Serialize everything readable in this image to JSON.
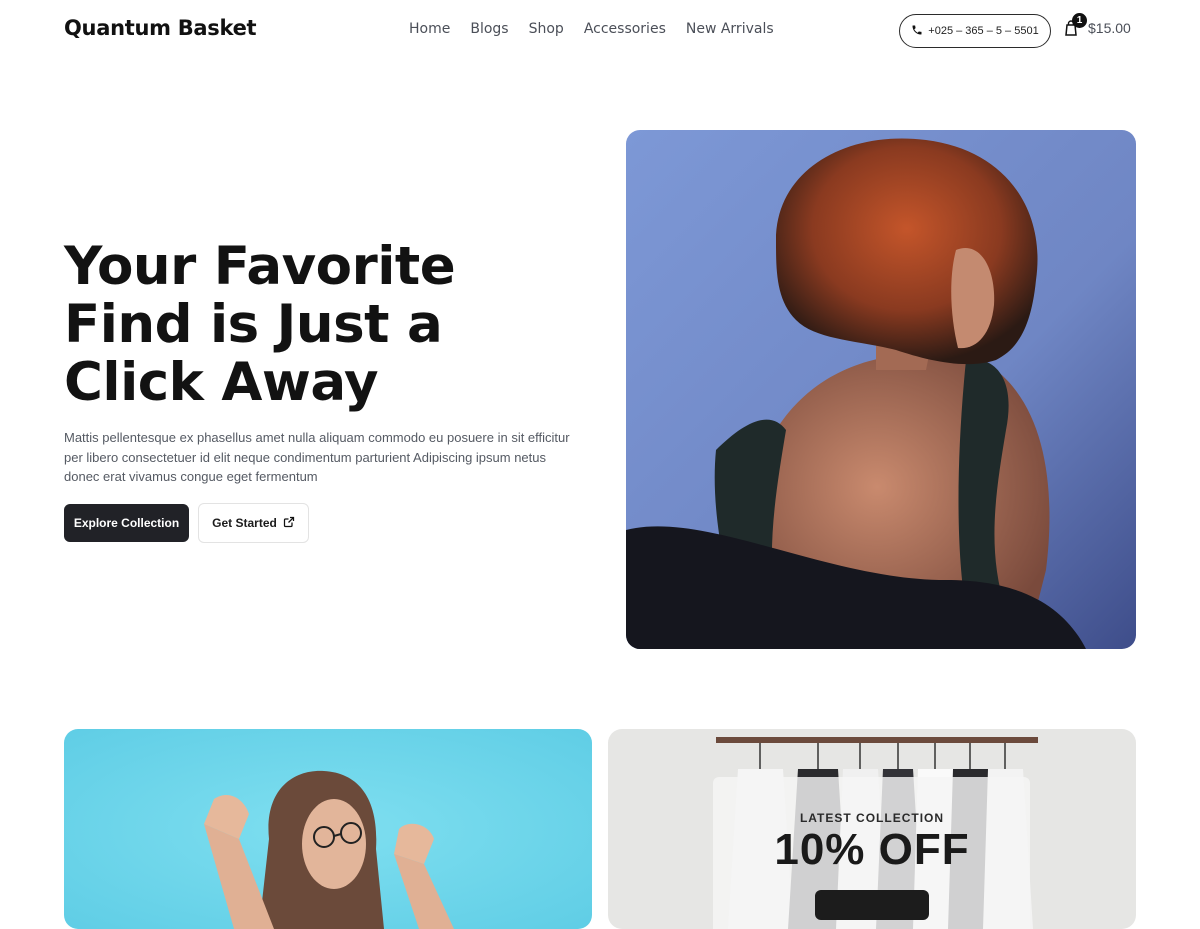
{
  "header": {
    "logo": "Quantum Basket",
    "nav": [
      "Home",
      "Blogs",
      "Shop",
      "Accessories",
      "New Arrivals"
    ],
    "phone": "+025 – 365 – 5 – 5501",
    "cart_count": "1",
    "cart_total": "$15.00"
  },
  "hero": {
    "title": "Your Favorite Find is Just a Click Away",
    "description": "Mattis pellentesque ex phasellus amet nulla aliquam commodo eu posuere in sit efficitur per libero consectetuer id elit neque condimentum parturient Adipiscing ipsum netus donec erat vivamus congue eget fermentum",
    "primary_button": "Explore Collection",
    "secondary_button": "Get Started"
  },
  "promo": {
    "eyebrow": "LATEST COLLECTION",
    "headline": "10% OFF"
  },
  "colors": {
    "primary_button": "#212227",
    "hero_bg": "#7b97d2",
    "card_left_bg": "#6ad5ea"
  },
  "icons": {
    "phone": "phone-icon",
    "cart": "shopping-bag-icon",
    "external": "external-link-icon"
  }
}
